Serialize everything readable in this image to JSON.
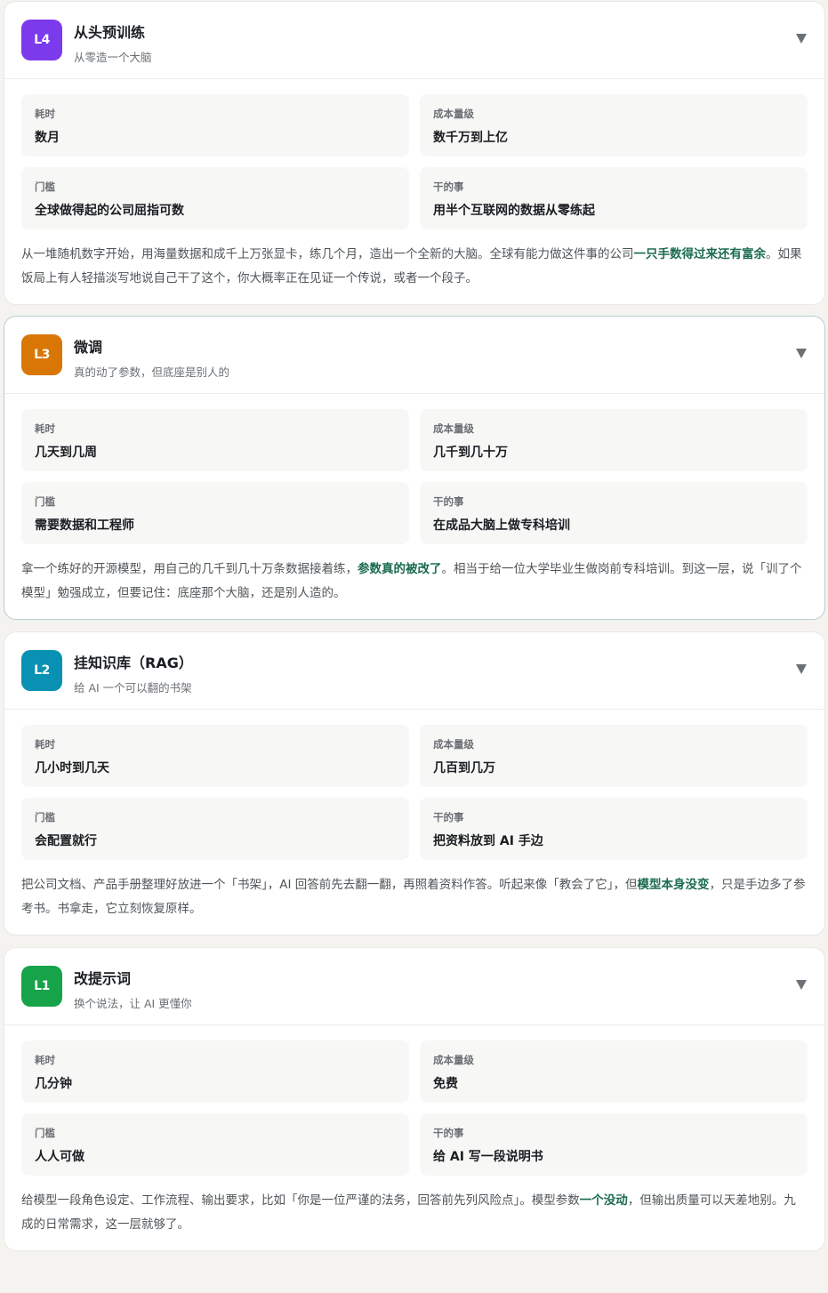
{
  "levels": [
    {
      "badge": "L4",
      "badge_color": "#7c3aed",
      "title": "从头预训练",
      "subtitle": "从零造一个大脑",
      "fields": [
        {
          "label": "耗时",
          "value": "数月"
        },
        {
          "label": "成本量级",
          "value": "数千万到上亿"
        },
        {
          "label": "门槛",
          "value": "全球做得起的公司屈指可数"
        },
        {
          "label": "干的事",
          "value": "用半个互联网的数据从零练起"
        }
      ],
      "desc_before": "从一堆随机数字开始，用海量数据和成千上万张显卡，练几个月，造出一个全新的大脑。全球有能力做这件事的公司",
      "desc_strong": "一只手数得过来还有富余",
      "desc_after": "。如果饭局上有人轻描淡写地说自己干了这个，你大概率正在见证一个传说，或者一个段子。"
    },
    {
      "badge": "L3",
      "badge_color": "#d97706",
      "title": "微调",
      "subtitle": "真的动了参数，但底座是别人的",
      "fields": [
        {
          "label": "耗时",
          "value": "几天到几周"
        },
        {
          "label": "成本量级",
          "value": "几千到几十万"
        },
        {
          "label": "门槛",
          "value": "需要数据和工程师"
        },
        {
          "label": "干的事",
          "value": "在成品大脑上做专科培训"
        }
      ],
      "desc_before": "拿一个练好的开源模型，用自己的几千到几十万条数据接着练，",
      "desc_strong": "参数真的被改了",
      "desc_after": "。相当于给一位大学毕业生做岗前专科培训。到这一层，说「训了个模型」勉强成立，但要记住：底座那个大脑，还是别人造的。"
    },
    {
      "badge": "L2",
      "badge_color": "#0891b2",
      "title": "挂知识库（RAG）",
      "subtitle": "给 AI 一个可以翻的书架",
      "fields": [
        {
          "label": "耗时",
          "value": "几小时到几天"
        },
        {
          "label": "成本量级",
          "value": "几百到几万"
        },
        {
          "label": "门槛",
          "value": "会配置就行"
        },
        {
          "label": "干的事",
          "value": "把资料放到 AI 手边"
        }
      ],
      "desc_before": "把公司文档、产品手册整理好放进一个「书架」，AI 回答前先去翻一翻，再照着资料作答。听起来像「教会了它」，但",
      "desc_strong": "模型本身没变",
      "desc_after": "，只是手边多了参考书。书拿走，它立刻恢复原样。"
    },
    {
      "badge": "L1",
      "badge_color": "#16a34a",
      "title": "改提示词",
      "subtitle": "换个说法，让 AI 更懂你",
      "fields": [
        {
          "label": "耗时",
          "value": "几分钟"
        },
        {
          "label": "成本量级",
          "value": "免费"
        },
        {
          "label": "门槛",
          "value": "人人可做"
        },
        {
          "label": "干的事",
          "value": "给 AI 写一段说明书"
        }
      ],
      "desc_before": "给模型一段角色设定、工作流程、输出要求，比如「你是一位严谨的法务，回答前先列风险点」。模型参数",
      "desc_strong": "一个没动",
      "desc_after": "，但输出质量可以天差地别。九成的日常需求，这一层就够了。"
    }
  ]
}
